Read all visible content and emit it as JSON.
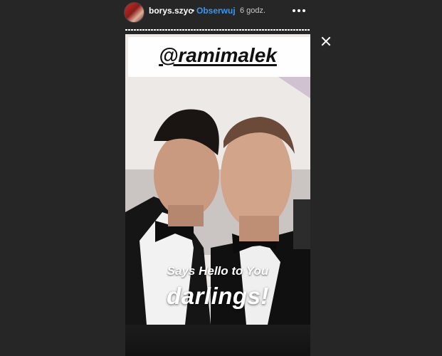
{
  "header": {
    "username": "borys.szyc",
    "separator": "•",
    "follow_label": "Obserwuj",
    "time_ago": "6 godz."
  },
  "story": {
    "progress_fraction": 1.0,
    "mention": "@ramimalek",
    "caption_line1": "Says Hello to You",
    "caption_line2": "darlings!"
  },
  "icons": {
    "more": "more-horizontal-icon",
    "close": "close-icon"
  },
  "colors": {
    "background": "#262626",
    "follow_blue": "#3897f0",
    "text_white": "#ffffff"
  }
}
